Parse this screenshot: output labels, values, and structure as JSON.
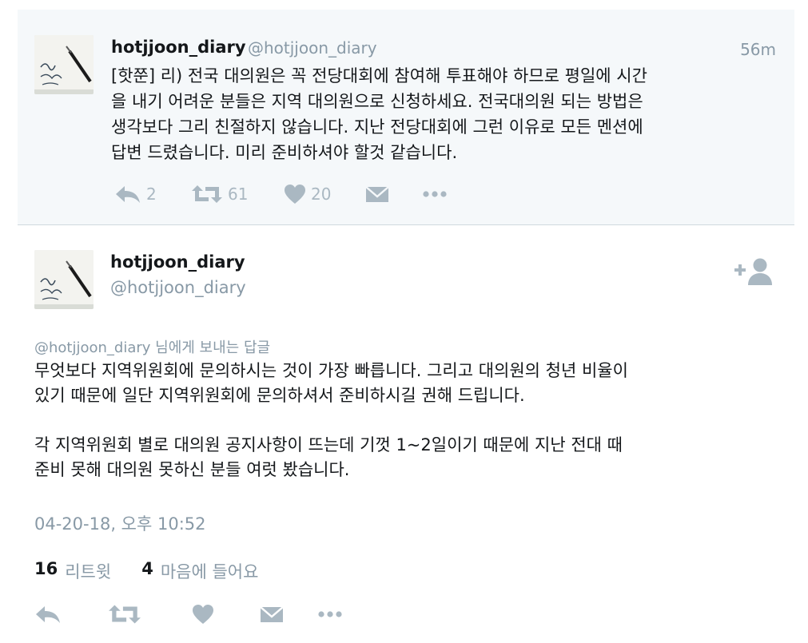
{
  "parent_tweet": {
    "name": "hotjjoon_diary",
    "handle": "@hotjjoon_diary",
    "time": "56m",
    "text": "[핫쭌] 리) 전국 대의원은 꼭 전당대회에 참여해 투표해야 하므로 평일에 시간을 내기 어려운 분들은 지역 대의원으로 신청하세요. 전국대의원 되는 방법은 생각보다 그리 친절하지 않습니다. 지난 전당대회에 그런 이유로 모든 멘션에 답변 드렸습니다. 미리 준비하셔야 할것 같습니다.",
    "lines": [
      "[핫쭌] 리) 전국 대의원은 꼭 전당대회에 참여해 투표해야 하므로 평일에 시간",
      "을 내기 어려운 분들은 지역 대의원으로 신청하세요. 전국대의원 되는 방법은",
      "생각보다 그리 친절하지 않습니다. 지난 전당대회에 그런 이유로 모든 멘션에",
      "답변 드렸습니다. 미리 준비하셔야 할것 같습니다."
    ],
    "reply_count": "2",
    "retweet_count": "61",
    "like_count": "20"
  },
  "main_tweet": {
    "name": "hotjjoon_diary",
    "handle": "@hotjjoon_diary",
    "reply_to_handle": "@hotjjoon_diary",
    "reply_to_suffix": " 님에게 보내는 답글",
    "para1_line1": "무엇보다 지역위원회에 문의하시는 것이 가장 빠릅니다. 그리고 대의원의 청년 비율이",
    "para1_line2": "있기 때문에 일단 지역위원회에 문의하셔서 준비하시길 권해 드립니다.",
    "para2_line1": "각 지역위원회 별로 대의원 공지사항이 뜨는데 기껏 1~2일이기 때문에 지난 전대 때",
    "para2_line2": "준비 못해 대의원 못하신 분들 여럿 봤습니다.",
    "date": "04-20-18, 오후 10:52",
    "retweets_num": "16",
    "retweets_label": "리트윗",
    "likes_num": "4",
    "likes_label": "마음에 들어요"
  },
  "icons": {
    "reply": "reply-icon",
    "retweet": "retweet-icon",
    "like": "heart-icon",
    "dm": "envelope-icon",
    "more": "more-icon",
    "follow": "follow-user-icon"
  },
  "colors": {
    "icon_gray": "#aab8c2",
    "meta_gray": "#8899a6",
    "text": "#14171a",
    "parent_bg": "#f5f8fa"
  }
}
